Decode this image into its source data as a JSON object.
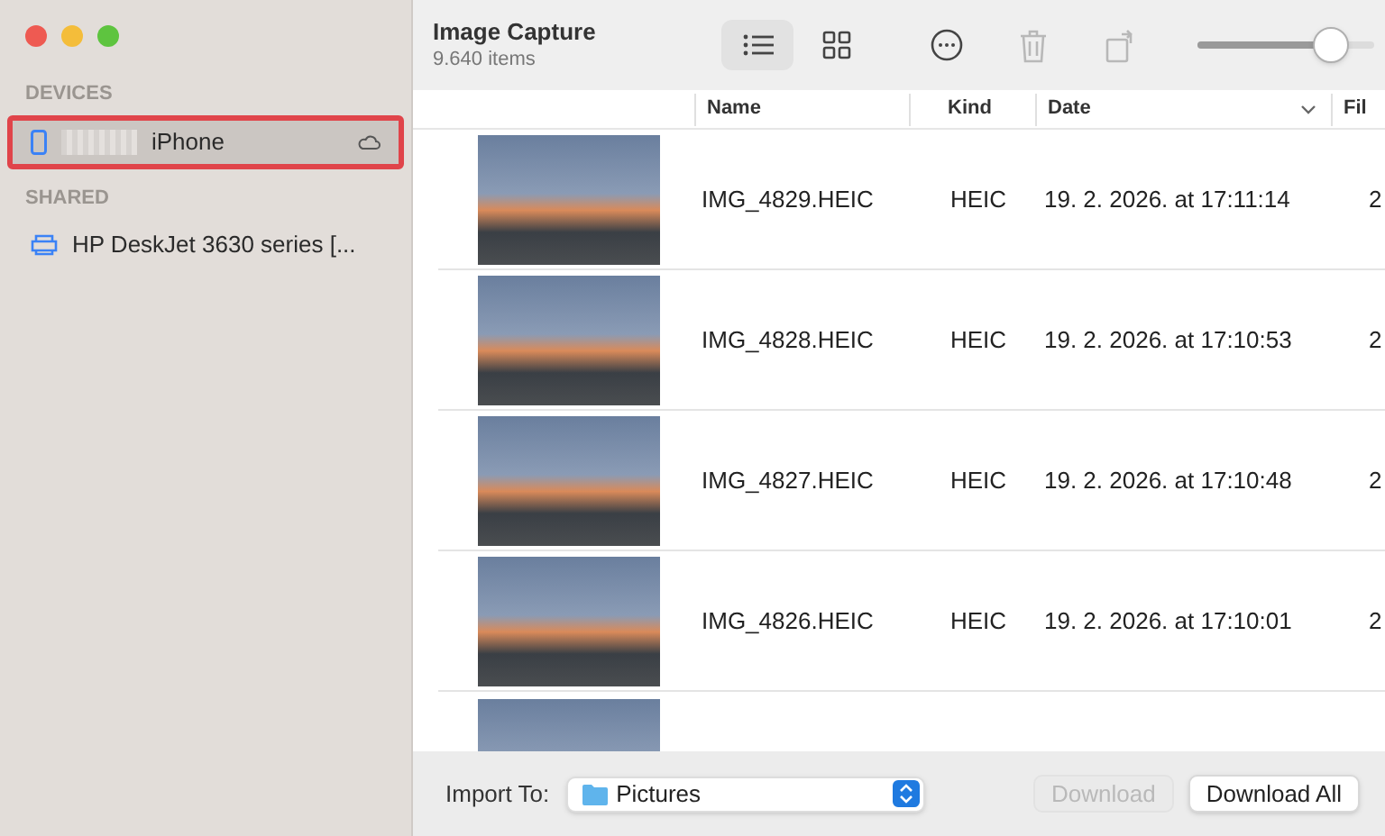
{
  "window": {
    "title": "Image Capture",
    "subtitle": "9.640 items"
  },
  "sidebar": {
    "sections": [
      {
        "heading": "DEVICES",
        "items": [
          {
            "kind": "phone",
            "label": "iPhone",
            "selected": true,
            "highlighted": true,
            "cloud": true
          }
        ]
      },
      {
        "heading": "SHARED",
        "items": [
          {
            "kind": "printer",
            "label": "HP DeskJet 3630 series [...",
            "selected": false,
            "highlighted": false,
            "cloud": false
          }
        ]
      }
    ]
  },
  "toolbar": {
    "views": [
      {
        "kind": "list",
        "selected": true
      },
      {
        "kind": "grid",
        "selected": false
      }
    ],
    "delete_disabled": true,
    "rotate_disabled": true,
    "zoom": {
      "level": 0.75
    }
  },
  "table": {
    "columns": [
      {
        "label": "Name",
        "sorted": false
      },
      {
        "label": "Kind",
        "sorted": false
      },
      {
        "label": "Date",
        "sorted": true
      },
      {
        "label": "Fil",
        "sorted": false
      }
    ],
    "rows": [
      {
        "name": "IMG_4829.HEIC",
        "kind": "HEIC",
        "date": "19. 2. 2026. at 17:11:14",
        "column_4": "2"
      },
      {
        "name": "IMG_4828.HEIC",
        "kind": "HEIC",
        "date": "19. 2. 2026. at 17:10:53",
        "column_4": "2"
      },
      {
        "name": "IMG_4827.HEIC",
        "kind": "HEIC",
        "date": "19. 2. 2026. at 17:10:48",
        "column_4": "2"
      },
      {
        "name": "IMG_4826.HEIC",
        "kind": "HEIC",
        "date": "19. 2. 2026. at 17:10:01",
        "column_4": "2"
      }
    ]
  },
  "footer": {
    "import_label": "Import To:",
    "destination": "Pictures",
    "buttons": [
      {
        "label": "Download",
        "disabled": true
      },
      {
        "label": "Download All",
        "disabled": false
      }
    ]
  }
}
